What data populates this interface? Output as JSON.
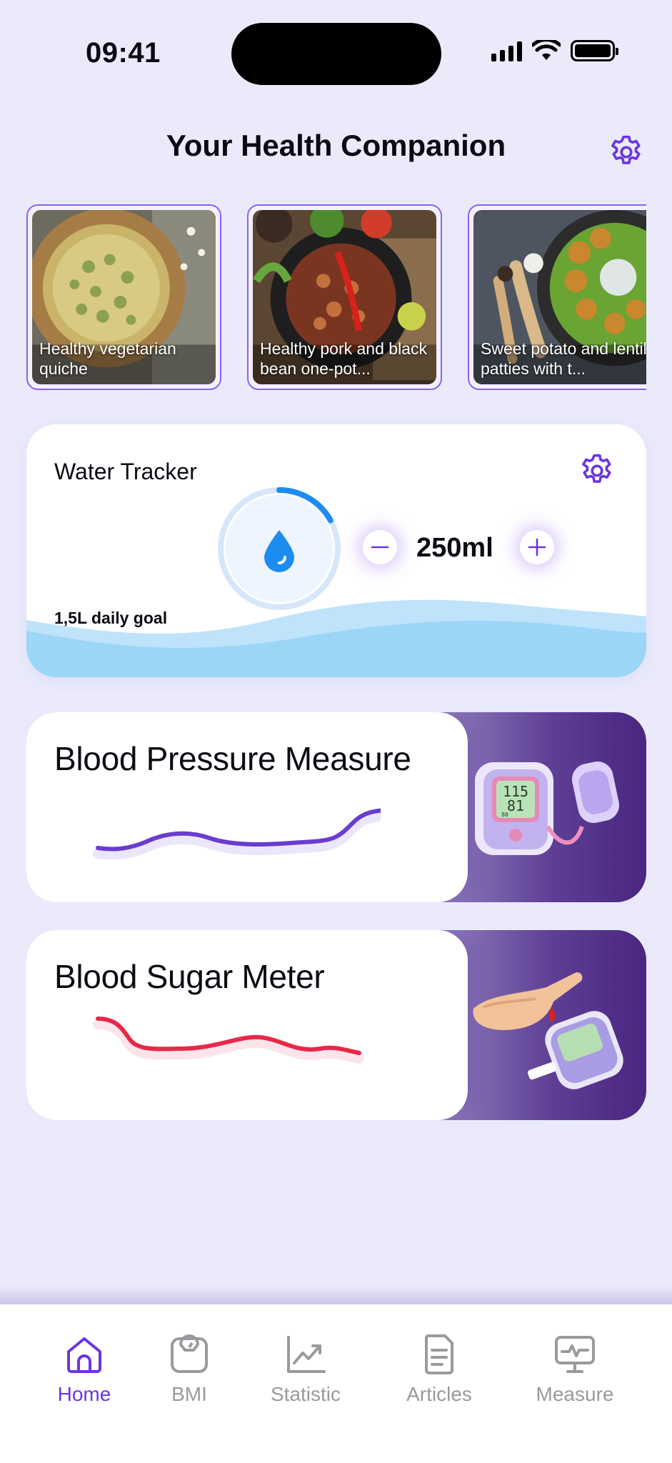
{
  "status_bar": {
    "time": "09:41"
  },
  "header": {
    "title": "Your Health Companion"
  },
  "recipes": [
    {
      "label": "Healthy vegetarian quiche"
    },
    {
      "label": "Healthy pork and black bean one-pot..."
    },
    {
      "label": "Sweet potato and lentil patties with t..."
    }
  ],
  "water_tracker": {
    "title": "Water Tracker",
    "amount": "250ml",
    "goal": "1,5L daily goal",
    "progress_fraction": 0.17
  },
  "measures": {
    "blood_pressure": {
      "title": "Blood Pressure Measure",
      "monitor_top": "115",
      "monitor_bottom": "81",
      "monitor_small": "80"
    },
    "blood_sugar": {
      "title": "Blood Sugar Meter"
    }
  },
  "nav": {
    "items": [
      {
        "label": "Home",
        "icon": "home-icon",
        "active": true
      },
      {
        "label": "BMI",
        "icon": "scale-icon",
        "active": false
      },
      {
        "label": "Statistic",
        "icon": "chart-icon",
        "active": false
      },
      {
        "label": "Articles",
        "icon": "document-icon",
        "active": false
      },
      {
        "label": "Measure",
        "icon": "monitor-icon",
        "active": false
      }
    ]
  },
  "colors": {
    "accent": "#6b35e0",
    "background": "#eaeafb",
    "water_blue": "#1d8cf0",
    "bp_line": "#6a3cd0",
    "bs_line": "#e8284a"
  }
}
